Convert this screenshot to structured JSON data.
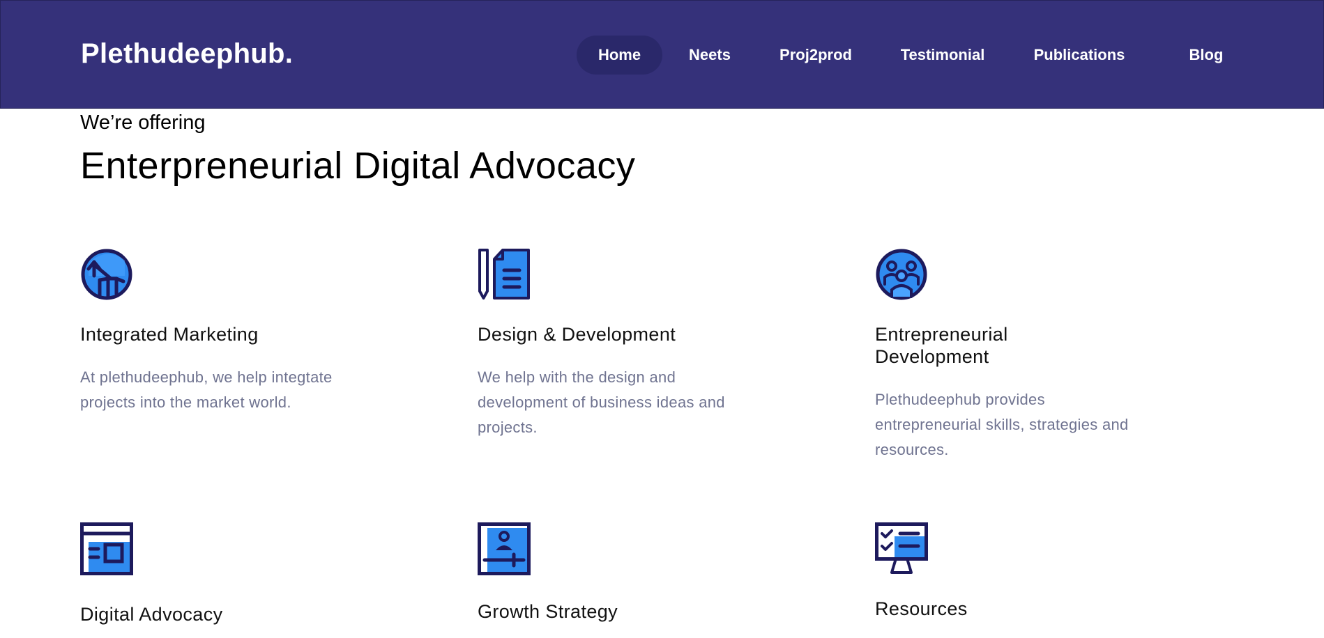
{
  "header": {
    "logo": "Plethudeephub.",
    "nav": [
      {
        "label": "Home",
        "active": true
      },
      {
        "label": "Neets",
        "active": false
      },
      {
        "label": "Proj2prod",
        "active": false
      },
      {
        "label": "Testimonial",
        "active": false
      },
      {
        "label": "Publications",
        "active": false
      },
      {
        "label": "Blog",
        "active": false
      }
    ]
  },
  "intro": {
    "kicker": "We’re offering",
    "headline": "Enterpreneurial Digital Advocacy"
  },
  "services": [
    {
      "title": "Integrated Marketing",
      "description": "At plethudeephub, we help integtate projects into the market world.",
      "icon": "growth-chart-icon"
    },
    {
      "title": "Design & Development",
      "description": "We help with the design and development of business ideas and projects.",
      "icon": "pencil-document-icon"
    },
    {
      "title": "Entrepreneurial Development",
      "description": "Plethudeephub provides entrepreneurial skills, strategies and resources.",
      "icon": "team-group-icon"
    },
    {
      "title": "Digital Advocacy",
      "description": "",
      "icon": "browser-window-icon"
    },
    {
      "title": "Growth Strategy",
      "description": "",
      "icon": "profile-card-icon"
    },
    {
      "title": "Resources",
      "description": "",
      "icon": "checklist-monitor-icon"
    }
  ],
  "colors": {
    "header_bg": "#35317a",
    "active_nav_bg": "#2a286a",
    "icon_dark": "#1d1a5c",
    "icon_blue": "#2f8bf0",
    "muted_text": "#6f7390"
  }
}
